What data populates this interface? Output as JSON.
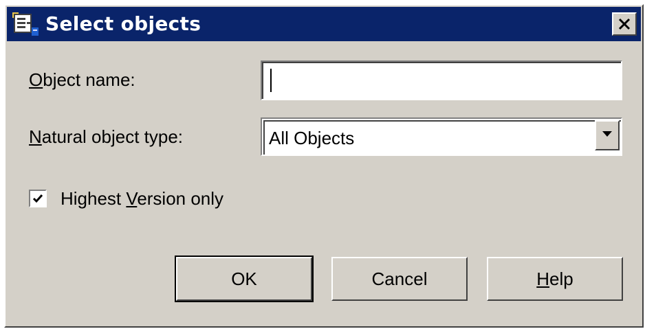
{
  "window": {
    "title": "Select objects",
    "title_icon": "app-icon",
    "close_icon": "close-icon",
    "titlebar_color": "#0a246a",
    "background_color": "#d4d0c8"
  },
  "form": {
    "object_name": {
      "label_prefix": "",
      "label_accel": "O",
      "label_rest": "bject name:",
      "value": "",
      "placeholder": ""
    },
    "object_type": {
      "label_prefix": "",
      "label_accel": "N",
      "label_rest": "atural object type:",
      "selected": "All Objects",
      "dropdown_icon": "chevron-down-icon"
    },
    "highest_version": {
      "label_prefix": "Highest ",
      "label_accel": "V",
      "label_rest": "ersion only",
      "checked": true,
      "check_icon": "checkmark-icon"
    }
  },
  "buttons": {
    "ok": {
      "label": "OK"
    },
    "cancel": {
      "label": "Cancel"
    },
    "help": {
      "label_accel": "H",
      "label_rest": "elp"
    }
  }
}
